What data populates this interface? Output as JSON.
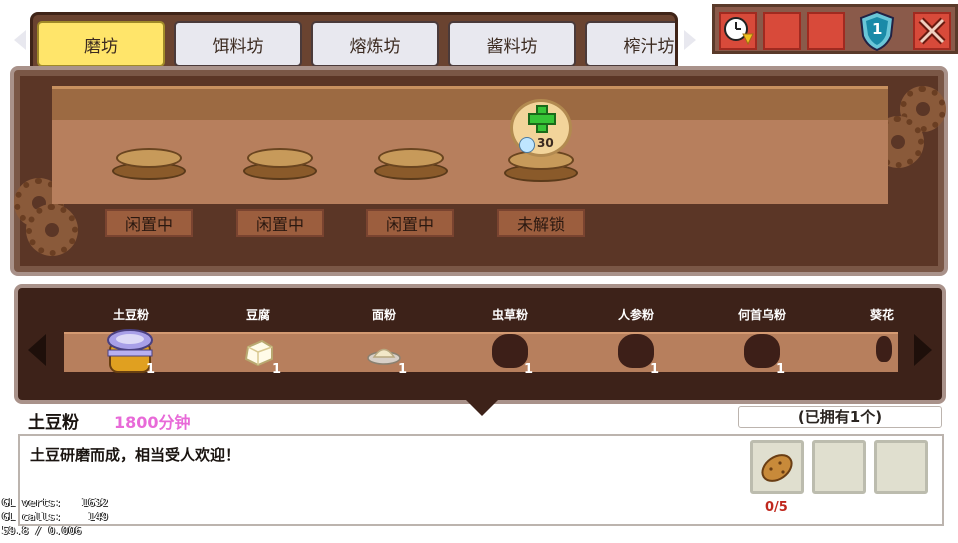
{
  "tabs": [
    {
      "label": "磨坊",
      "active": true
    },
    {
      "label": "饵料坊",
      "active": false
    },
    {
      "label": "熔炼坊",
      "active": false
    },
    {
      "label": "酱料坊",
      "active": false
    },
    {
      "label": "榨汁坊",
      "active": false
    }
  ],
  "top_buttons": {
    "clock_icon": "clock-speedup-icon",
    "shield_level": "1",
    "close_icon": "close-icon"
  },
  "stations": [
    {
      "status": "闲置中"
    },
    {
      "status": "闲置中"
    },
    {
      "status": "闲置中"
    },
    {
      "status": "未解锁"
    }
  ],
  "unlock": {
    "cost": "30",
    "icon": "plus-icon"
  },
  "items": [
    {
      "name": "土豆粉",
      "count": "1",
      "known": true
    },
    {
      "name": "豆腐",
      "count": "1",
      "known": true
    },
    {
      "name": "面粉",
      "count": "1",
      "known": true
    },
    {
      "name": "虫草粉",
      "count": "1",
      "known": false
    },
    {
      "name": "人参粉",
      "count": "1",
      "known": false
    },
    {
      "name": "何首乌粉",
      "count": "1",
      "known": false
    },
    {
      "name": "葵花",
      "count": "",
      "known": false
    }
  ],
  "selected": {
    "name": "土豆粉",
    "time": "1800分钟",
    "owned": "(已拥有1个)",
    "description": "土豆研磨而成，相当受人欢迎！",
    "ingredient_count": "0/5"
  },
  "debug": {
    "line1": "GL verts:   1632",
    "line2": "GL calls:    149",
    "line3": "59.8 / 0.006"
  },
  "colors": {
    "active_tab": "#ffe56a",
    "time": "#e86ad8",
    "count_red": "#c0281e"
  }
}
